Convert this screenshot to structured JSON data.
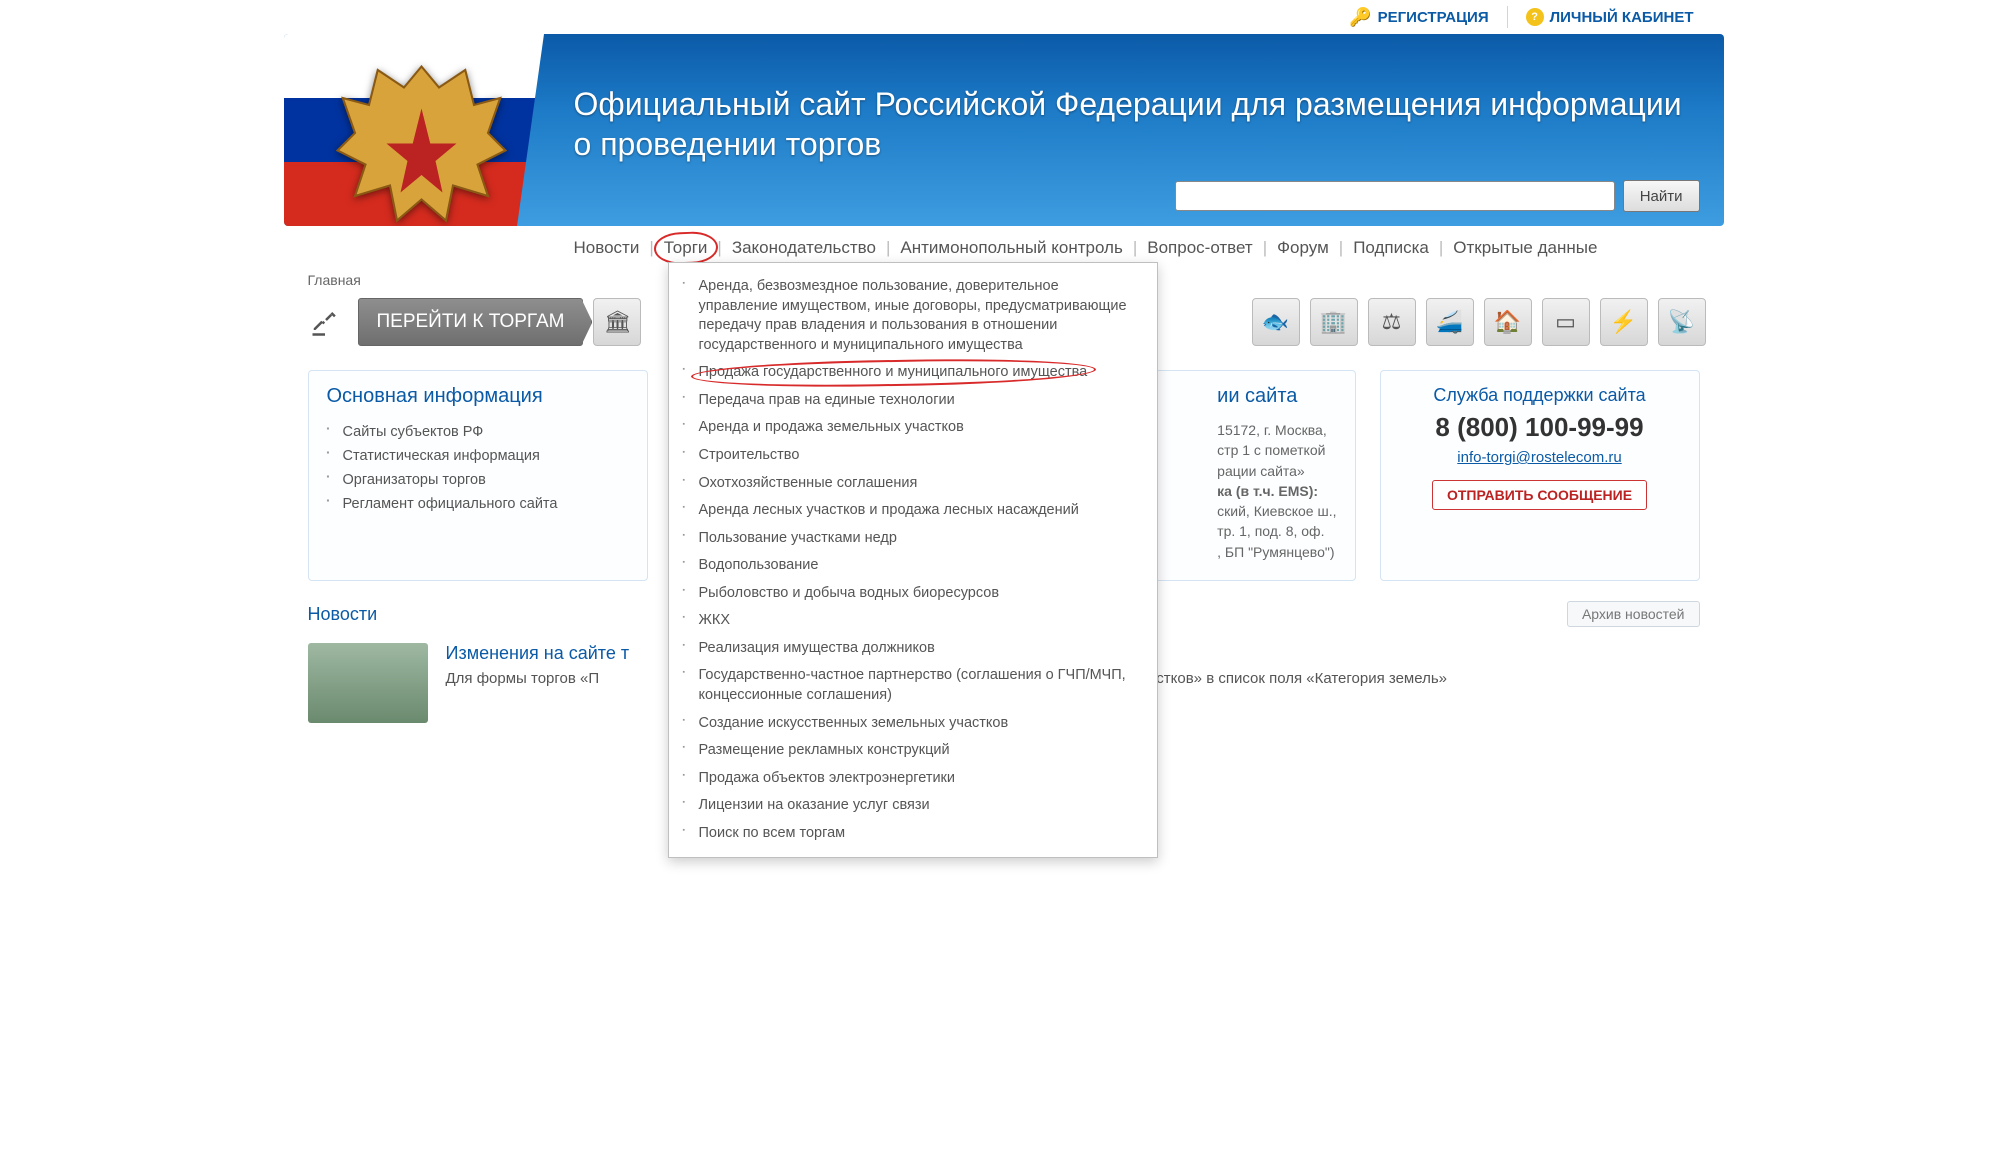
{
  "topbar": {
    "register": "РЕГИСТРАЦИЯ",
    "account": "ЛИЧНЫЙ КАБИНЕТ"
  },
  "header": {
    "title": "Официальный сайт Российской Федерации для размещения информации о проведении торгов",
    "search_button": "Найти",
    "search_placeholder": ""
  },
  "mainnav": [
    "Новости",
    "Торги",
    "Законодательство",
    "Антимонопольный контроль",
    "Вопрос-ответ",
    "Форум",
    "Подписка",
    "Открытые данные"
  ],
  "breadcrumb": "Главная",
  "go_label": "ПЕРЕЙТИ К ТОРГАМ",
  "dropdown": [
    "Аренда, безвозмездное пользование, доверительное управление имуществом, иные договоры, предусматривающие передачу прав владения и пользования в отношении государственного и муниципального имущества",
    "Продажа государственного и муниципального имущества",
    "Передача прав на единые технологии",
    "Аренда и продажа земельных участков",
    "Строительство",
    "Охотхозяйственные соглашения",
    "Аренда лесных участков и продажа лесных насаждений",
    "Пользование участками недр",
    "Водопользование",
    "Рыболовство и добыча водных биоресурсов",
    "ЖКХ",
    "Реализация имущества должников",
    "Государственно-частное партнерство (соглашения о ГЧП/МЧП, концессионные соглашения)",
    "Создание искусственных земельных участков",
    "Размещение рекламных конструкций",
    "Продажа объектов электроэнергетики",
    "Лицензии на оказание услуг связи",
    "Поиск по всем торгам"
  ],
  "info": {
    "title": "Основная информация",
    "items": [
      "Сайты субъектов РФ",
      "Статистическая информация",
      "Организаторы торгов",
      "Регламент официального сайта"
    ]
  },
  "contact": {
    "title_suffix": "ии сайта",
    "addr1": "15172, г. Москва,",
    "addr2": "стр 1 с пометкой",
    "addr3": "рации сайта»",
    "addr4": "ка (в т.ч. EMS):",
    "addr5": "ский, Киевское ш.,",
    "addr6": "тр. 1, под. 8, оф.",
    "addr7": ", БП \"Румянцево\")"
  },
  "support": {
    "title": "Служба поддержки сайта",
    "phone": "8 (800) 100-99-99",
    "email": "info-torgi@rostelecom.ru",
    "button": "ОТПРАВИТЬ СООБЩЕНИЕ"
  },
  "news": {
    "heading": "Новости",
    "archive": "Архив новостей",
    "item_title": "Изменения на сайте т",
    "item_text_prefix": "Для формы торгов «П",
    "item_text_suffix": "ельных участков» в список поля «Категория земель»"
  },
  "cat_icons": [
    "bank-icon",
    "fish-icon",
    "building-icon",
    "scales-icon",
    "train-icon",
    "house-water-icon",
    "billboard-icon",
    "power-icon",
    "antenna-icon"
  ]
}
